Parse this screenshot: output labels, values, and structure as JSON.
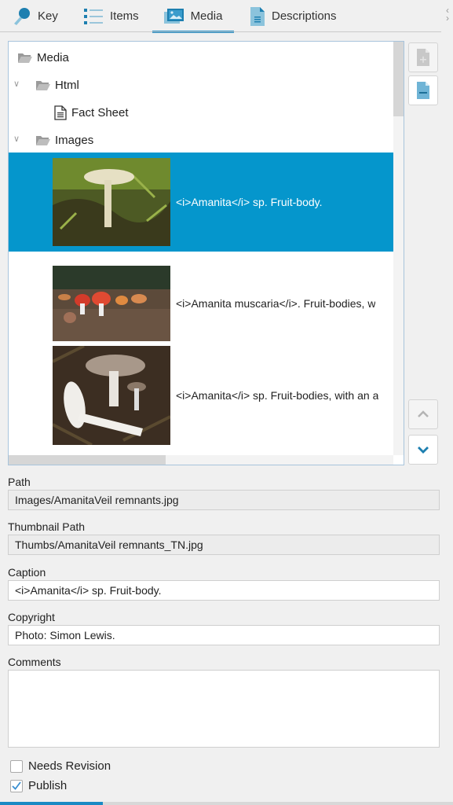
{
  "tabs": [
    {
      "label": "Key",
      "icon": "key-icon",
      "active": false
    },
    {
      "label": "Items",
      "icon": "list-icon",
      "active": false
    },
    {
      "label": "Media",
      "icon": "image-icon",
      "active": true
    },
    {
      "label": "Descriptions",
      "icon": "document-icon",
      "active": false
    }
  ],
  "tree": {
    "root": "Media",
    "folders": [
      {
        "label": "Html",
        "expanded": true,
        "children": [
          "Fact Sheet"
        ]
      },
      {
        "label": "Images",
        "expanded": true
      }
    ],
    "media_items": [
      {
        "caption": "<i>Amanita</i> sp. Fruit-body.",
        "selected": true
      },
      {
        "caption": "<i>Amanita muscaria</i>. Fruit-bodies, w",
        "selected": false
      },
      {
        "caption": "<i>Amanita</i> sp. Fruit-bodies, with an a",
        "selected": false
      }
    ]
  },
  "side_buttons": {
    "add": "add-media-button",
    "remove": "remove-media-button",
    "up": "move-up-button",
    "down": "move-down-button"
  },
  "form": {
    "path_label": "Path",
    "path_value": "Images/AmanitaVeil remnants.jpg",
    "thumb_label": "Thumbnail Path",
    "thumb_value": "Thumbs/AmanitaVeil remnants_TN.jpg",
    "caption_label": "Caption",
    "caption_value": "<i>Amanita</i> sp. Fruit-body.",
    "copyright_label": "Copyright",
    "copyright_value": "Photo: Simon Lewis.",
    "comments_label": "Comments",
    "comments_value": "",
    "needs_revision_label": "Needs Revision",
    "needs_revision_checked": false,
    "publish_label": "Publish",
    "publish_checked": true
  },
  "colors": {
    "accent": "#1a8ac4",
    "selection": "#0596cc"
  }
}
